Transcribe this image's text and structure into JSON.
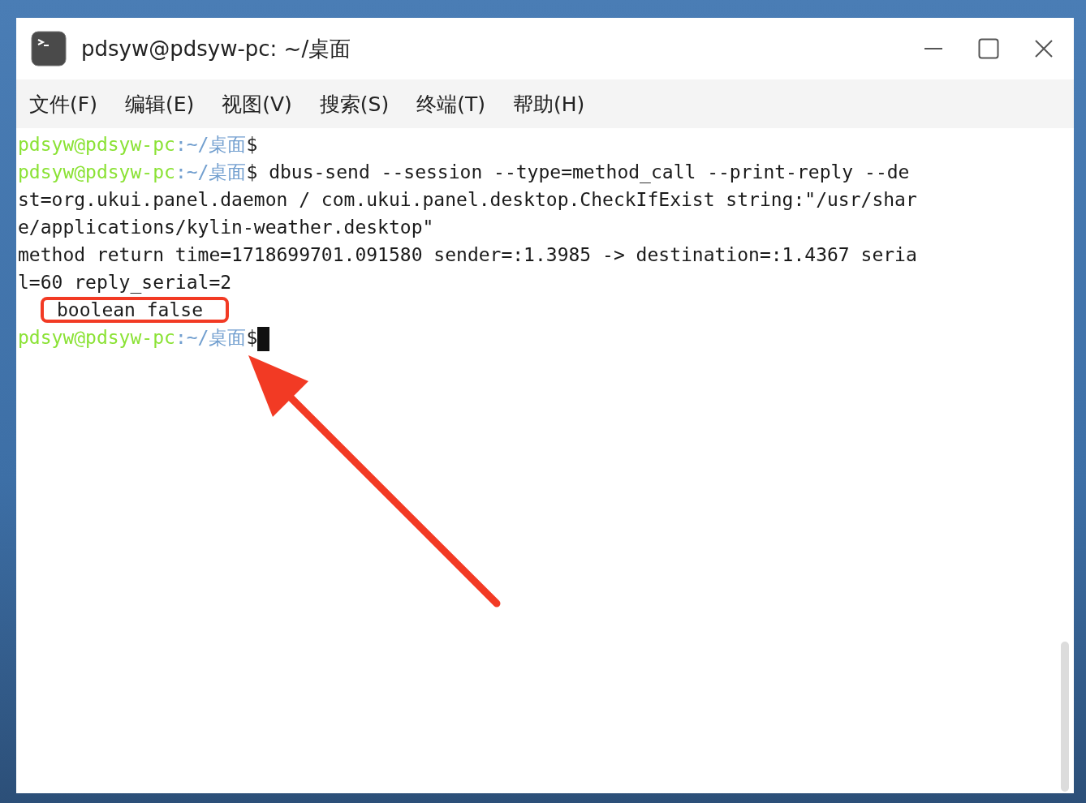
{
  "window": {
    "title": "pdsyw@pdsyw-pc: ~/桌面"
  },
  "menu": [
    "文件(F)",
    "编辑(E)",
    "视图(V)",
    "搜索(S)",
    "终端(T)",
    "帮助(H)"
  ],
  "terminal": {
    "lines": [
      {
        "kind": "prompt",
        "user": "pdsyw@pdsyw-pc",
        "path": ":~/桌面",
        "symbol": "$"
      },
      {
        "kind": "prompt",
        "user": "pdsyw@pdsyw-pc",
        "path": ":~/桌面",
        "symbol": "$",
        "text": " dbus-send --session --type=method_call --print-reply --de"
      },
      {
        "kind": "output",
        "text": "st=org.ukui.panel.daemon / com.ukui.panel.desktop.CheckIfExist string:\"/usr/shar"
      },
      {
        "kind": "output",
        "text": "e/applications/kylin-weather.desktop\""
      },
      {
        "kind": "output",
        "text": "method return time=1718699701.091580 sender=:1.3985 -> destination=:1.4367 seria"
      },
      {
        "kind": "output",
        "text": "l=60 reply_serial=2"
      },
      {
        "kind": "output",
        "text": "   boolean false",
        "highlighted": true
      },
      {
        "kind": "prompt",
        "user": "pdsyw@pdsyw-pc",
        "path": ":~/桌面",
        "symbol": "$",
        "cursor": true
      }
    ]
  }
}
